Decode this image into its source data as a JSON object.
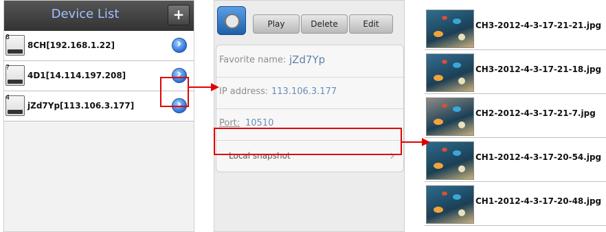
{
  "device_list": {
    "title": "Device List",
    "add_button_label": "+",
    "devices": [
      {
        "num": "8",
        "label": "8CH[192.168.1.22]"
      },
      {
        "num": "?",
        "label": "4D1[14.114.197.208]"
      },
      {
        "num": "4",
        "label": "jZd7Yp[113.106.3.177]"
      }
    ]
  },
  "detail": {
    "buttons": {
      "play": "Play",
      "delete": "Delete",
      "edit": "Edit"
    },
    "favorite_label": "Favorite name:",
    "favorite_value": "jZd7Yp",
    "ip_label": "IP address:",
    "ip_value": "113.106.3.177",
    "port_label": "Port:",
    "port_value": "10510",
    "snapshot_label": "Local snapshot",
    "chevron": "›"
  },
  "snapshots": [
    {
      "name": "CH3-2012-4-3-17-21-21.jpg",
      "tone": "#2f6f8f"
    },
    {
      "name": "CH3-2012-4-3-17-21-18.jpg",
      "tone": "#356e92"
    },
    {
      "name": "CH2-2012-4-3-17-21-7.jpg",
      "tone": "#8d8c86"
    },
    {
      "name": "CH1-2012-4-3-17-20-54.jpg",
      "tone": "#2c6a8c"
    },
    {
      "name": "CH1-2012-4-3-17-20-48.jpg",
      "tone": "#2d6c8e"
    }
  ],
  "colors": {
    "annotation": "#e10000",
    "accent": "#2a6fd6"
  }
}
